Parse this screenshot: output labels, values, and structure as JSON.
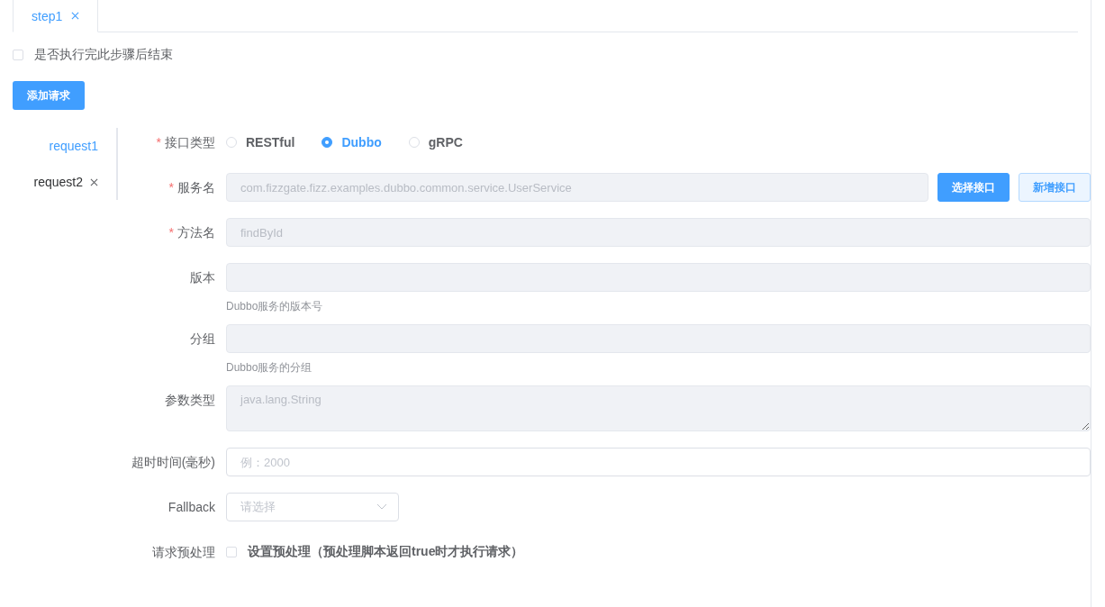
{
  "tabs": [
    {
      "label": "step1",
      "selected": true
    }
  ],
  "end_after_step": {
    "label": "是否执行完此步骤后结束",
    "checked": false
  },
  "add_request_button": "添加请求",
  "requests": [
    {
      "label": "request1",
      "selected": true,
      "closable": false
    },
    {
      "label": "request2",
      "selected": false,
      "closable": true
    }
  ],
  "form": [
    {
      "kind": "radio",
      "label": "接口类型",
      "required_mark": "*",
      "options": [
        {
          "label": "RESTful",
          "selected": false
        },
        {
          "label": "Dubbo",
          "selected": true
        },
        {
          "label": "gRPC",
          "selected": false
        }
      ]
    },
    {
      "kind": "input",
      "label": "服务名",
      "required_mark": "*",
      "value": "com.fizzgate.fizz.examples.dubbo.common.service.UserService",
      "disabled": true,
      "buttons": [
        {
          "label": "选择接口",
          "primary": true
        },
        {
          "label": "新增接口",
          "primary": false
        }
      ]
    },
    {
      "kind": "input",
      "label": "方法名",
      "required_mark": "*",
      "value": "findById",
      "disabled": true
    },
    {
      "kind": "input",
      "label": "版本",
      "disabled": true,
      "help": "Dubbo服务的版本号"
    },
    {
      "kind": "input",
      "label": "分组",
      "disabled": true,
      "help": "Dubbo服务的分组"
    },
    {
      "kind": "textarea",
      "label": "参数类型",
      "value": "java.lang.String",
      "disabled": true
    },
    {
      "kind": "input",
      "label": "超时时间(毫秒)",
      "placeholder": "例：2000",
      "disabled": false
    },
    {
      "kind": "select",
      "label": "Fallback",
      "placeholder": "请选择"
    },
    {
      "kind": "checkbox",
      "label": "请求预处理",
      "text": "设置预处理（预处理脚本返回true时才执行请求）",
      "checked": false
    }
  ]
}
